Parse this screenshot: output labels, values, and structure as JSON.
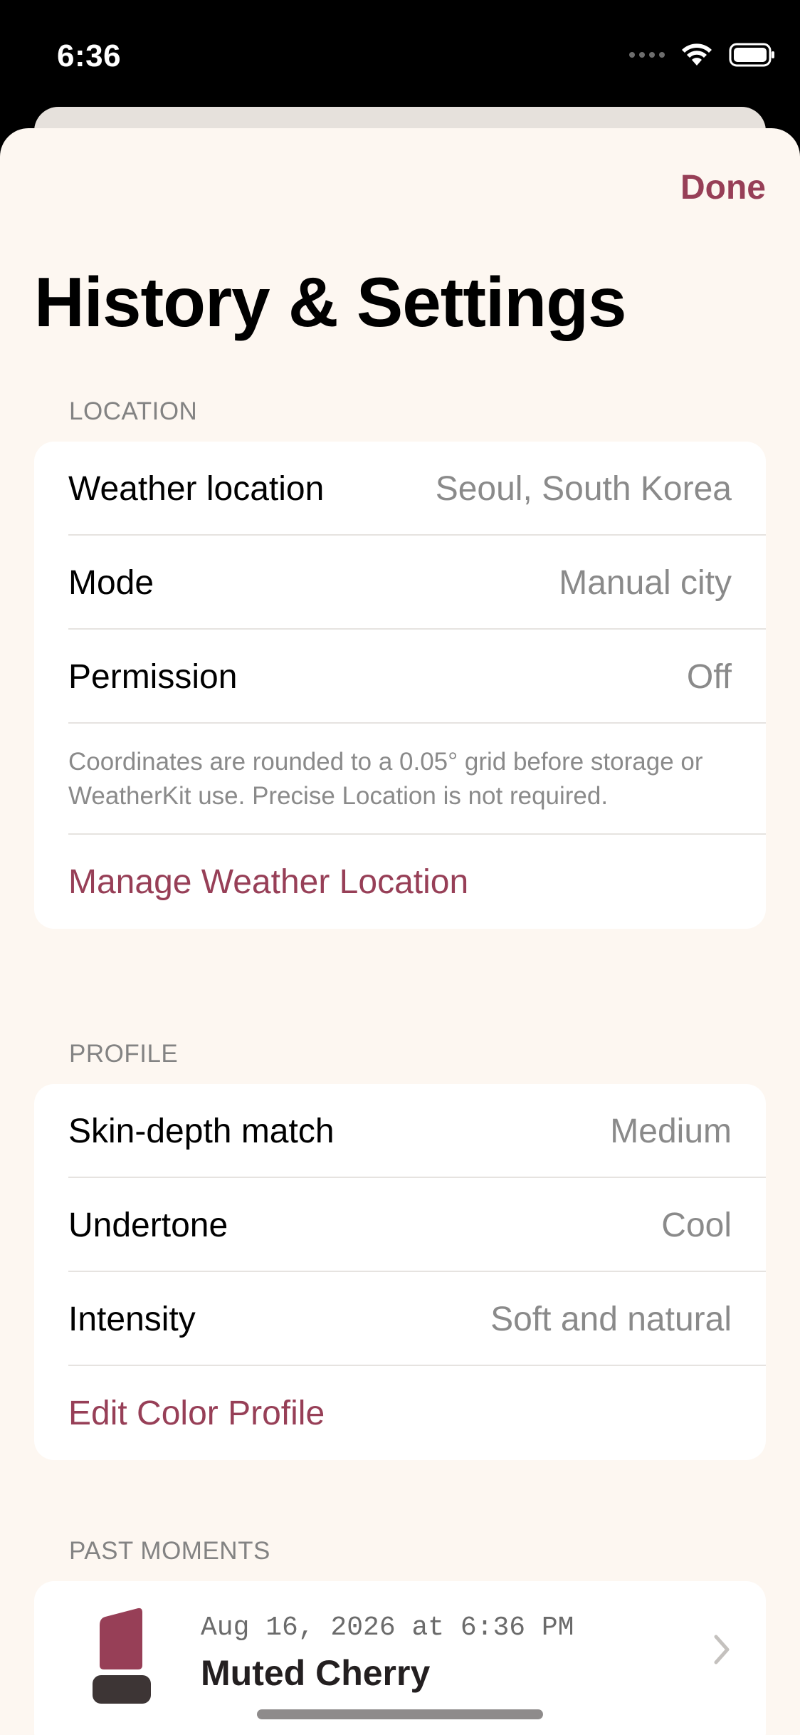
{
  "status_bar": {
    "time": "6:36"
  },
  "header": {
    "done_label": "Done",
    "title": "History & Settings"
  },
  "location": {
    "header": "LOCATION",
    "rows": [
      {
        "label": "Weather location",
        "value": "Seoul, South Korea"
      },
      {
        "label": "Mode",
        "value": "Manual city"
      },
      {
        "label": "Permission",
        "value": "Off"
      }
    ],
    "note": "Coordinates are rounded to a 0.05° grid before storage or WeatherKit use. Precise Location is not required.",
    "action": "Manage Weather Location"
  },
  "profile": {
    "header": "PROFILE",
    "rows": [
      {
        "label": "Skin-depth match",
        "value": "Medium"
      },
      {
        "label": "Undertone",
        "value": "Cool"
      },
      {
        "label": "Intensity",
        "value": "Soft and natural"
      }
    ],
    "action": "Edit Color Profile"
  },
  "past_moments": {
    "header": "PAST MOMENTS",
    "items": [
      {
        "date": "Aug 16, 2026 at 6:36 PM",
        "name": "Muted Cherry",
        "icon": "lipstick-icon"
      }
    ]
  },
  "colors": {
    "accent": "#973f57",
    "background": "#fdf7f1",
    "lipstick": "#973f57",
    "lipstick_base": "#3d3535"
  }
}
